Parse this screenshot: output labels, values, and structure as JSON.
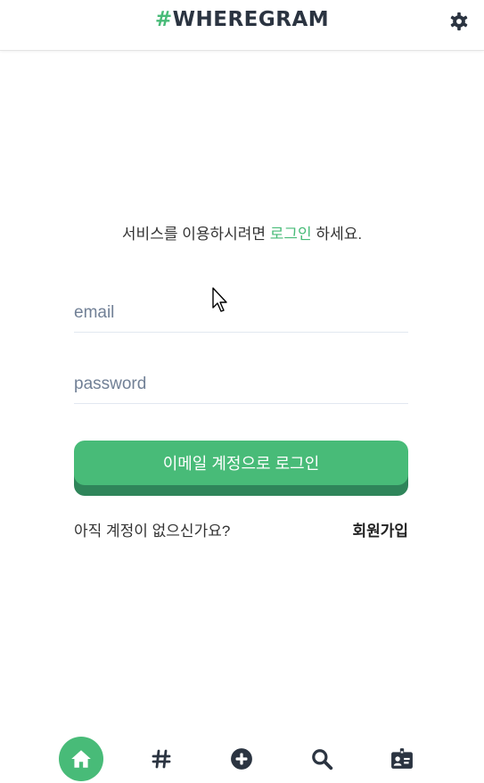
{
  "header": {
    "logo_hash": "#",
    "logo_text": "WHEREGRAM",
    "settings_icon": "gear-icon"
  },
  "login": {
    "prompt_before": "서비스를 이용하시려면 ",
    "prompt_link": "로그인",
    "prompt_after": " 하세요.",
    "email_placeholder": "email",
    "email_value": "",
    "password_placeholder": "password",
    "password_value": "",
    "login_button": "이메일 계정으로 로그인",
    "signup_question": "아직 계정이 없으신가요?",
    "signup_link": "회원가입"
  },
  "bottom_nav": {
    "items": [
      {
        "name": "home",
        "icon": "home-icon",
        "active": true
      },
      {
        "name": "tags",
        "icon": "hashtag-icon",
        "active": false
      },
      {
        "name": "add",
        "icon": "plus-circle-icon",
        "active": false
      },
      {
        "name": "search",
        "icon": "search-icon",
        "active": false
      },
      {
        "name": "profile",
        "icon": "id-card-icon",
        "active": false
      }
    ]
  },
  "colors": {
    "accent": "#48bb78",
    "accent_dark": "#2f855a",
    "text_dark": "#2b3441"
  }
}
